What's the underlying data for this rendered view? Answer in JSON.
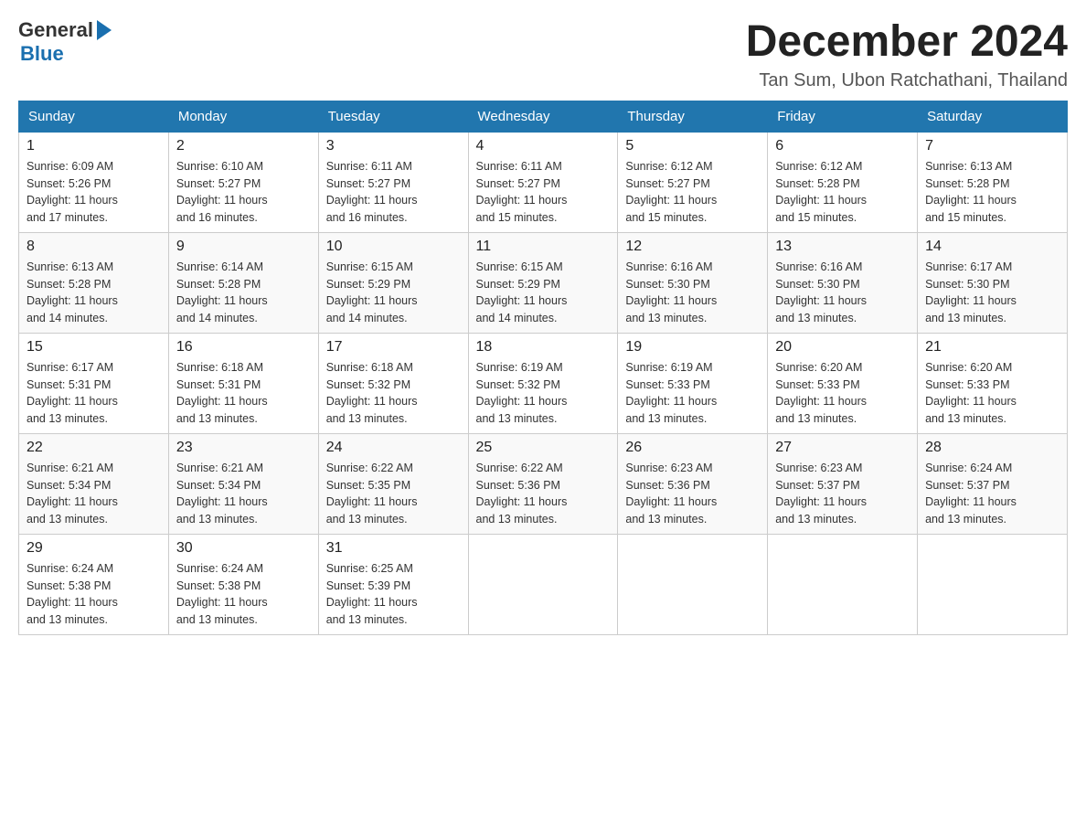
{
  "logo": {
    "general": "General",
    "arrow": "",
    "blue": "Blue"
  },
  "title": "December 2024",
  "subtitle": "Tan Sum, Ubon Ratchathani, Thailand",
  "weekdays": [
    "Sunday",
    "Monday",
    "Tuesday",
    "Wednesday",
    "Thursday",
    "Friday",
    "Saturday"
  ],
  "weeks": [
    [
      {
        "day": "1",
        "sunrise": "6:09 AM",
        "sunset": "5:26 PM",
        "daylight": "11 hours and 17 minutes."
      },
      {
        "day": "2",
        "sunrise": "6:10 AM",
        "sunset": "5:27 PM",
        "daylight": "11 hours and 16 minutes."
      },
      {
        "day": "3",
        "sunrise": "6:11 AM",
        "sunset": "5:27 PM",
        "daylight": "11 hours and 16 minutes."
      },
      {
        "day": "4",
        "sunrise": "6:11 AM",
        "sunset": "5:27 PM",
        "daylight": "11 hours and 15 minutes."
      },
      {
        "day": "5",
        "sunrise": "6:12 AM",
        "sunset": "5:27 PM",
        "daylight": "11 hours and 15 minutes."
      },
      {
        "day": "6",
        "sunrise": "6:12 AM",
        "sunset": "5:28 PM",
        "daylight": "11 hours and 15 minutes."
      },
      {
        "day": "7",
        "sunrise": "6:13 AM",
        "sunset": "5:28 PM",
        "daylight": "11 hours and 15 minutes."
      }
    ],
    [
      {
        "day": "8",
        "sunrise": "6:13 AM",
        "sunset": "5:28 PM",
        "daylight": "11 hours and 14 minutes."
      },
      {
        "day": "9",
        "sunrise": "6:14 AM",
        "sunset": "5:28 PM",
        "daylight": "11 hours and 14 minutes."
      },
      {
        "day": "10",
        "sunrise": "6:15 AM",
        "sunset": "5:29 PM",
        "daylight": "11 hours and 14 minutes."
      },
      {
        "day": "11",
        "sunrise": "6:15 AM",
        "sunset": "5:29 PM",
        "daylight": "11 hours and 14 minutes."
      },
      {
        "day": "12",
        "sunrise": "6:16 AM",
        "sunset": "5:30 PM",
        "daylight": "11 hours and 13 minutes."
      },
      {
        "day": "13",
        "sunrise": "6:16 AM",
        "sunset": "5:30 PM",
        "daylight": "11 hours and 13 minutes."
      },
      {
        "day": "14",
        "sunrise": "6:17 AM",
        "sunset": "5:30 PM",
        "daylight": "11 hours and 13 minutes."
      }
    ],
    [
      {
        "day": "15",
        "sunrise": "6:17 AM",
        "sunset": "5:31 PM",
        "daylight": "11 hours and 13 minutes."
      },
      {
        "day": "16",
        "sunrise": "6:18 AM",
        "sunset": "5:31 PM",
        "daylight": "11 hours and 13 minutes."
      },
      {
        "day": "17",
        "sunrise": "6:18 AM",
        "sunset": "5:32 PM",
        "daylight": "11 hours and 13 minutes."
      },
      {
        "day": "18",
        "sunrise": "6:19 AM",
        "sunset": "5:32 PM",
        "daylight": "11 hours and 13 minutes."
      },
      {
        "day": "19",
        "sunrise": "6:19 AM",
        "sunset": "5:33 PM",
        "daylight": "11 hours and 13 minutes."
      },
      {
        "day": "20",
        "sunrise": "6:20 AM",
        "sunset": "5:33 PM",
        "daylight": "11 hours and 13 minutes."
      },
      {
        "day": "21",
        "sunrise": "6:20 AM",
        "sunset": "5:33 PM",
        "daylight": "11 hours and 13 minutes."
      }
    ],
    [
      {
        "day": "22",
        "sunrise": "6:21 AM",
        "sunset": "5:34 PM",
        "daylight": "11 hours and 13 minutes."
      },
      {
        "day": "23",
        "sunrise": "6:21 AM",
        "sunset": "5:34 PM",
        "daylight": "11 hours and 13 minutes."
      },
      {
        "day": "24",
        "sunrise": "6:22 AM",
        "sunset": "5:35 PM",
        "daylight": "11 hours and 13 minutes."
      },
      {
        "day": "25",
        "sunrise": "6:22 AM",
        "sunset": "5:36 PM",
        "daylight": "11 hours and 13 minutes."
      },
      {
        "day": "26",
        "sunrise": "6:23 AM",
        "sunset": "5:36 PM",
        "daylight": "11 hours and 13 minutes."
      },
      {
        "day": "27",
        "sunrise": "6:23 AM",
        "sunset": "5:37 PM",
        "daylight": "11 hours and 13 minutes."
      },
      {
        "day": "28",
        "sunrise": "6:24 AM",
        "sunset": "5:37 PM",
        "daylight": "11 hours and 13 minutes."
      }
    ],
    [
      {
        "day": "29",
        "sunrise": "6:24 AM",
        "sunset": "5:38 PM",
        "daylight": "11 hours and 13 minutes."
      },
      {
        "day": "30",
        "sunrise": "6:24 AM",
        "sunset": "5:38 PM",
        "daylight": "11 hours and 13 minutes."
      },
      {
        "day": "31",
        "sunrise": "6:25 AM",
        "sunset": "5:39 PM",
        "daylight": "11 hours and 13 minutes."
      },
      null,
      null,
      null,
      null
    ]
  ],
  "labels": {
    "sunrise": "Sunrise:",
    "sunset": "Sunset:",
    "daylight": "Daylight:"
  }
}
